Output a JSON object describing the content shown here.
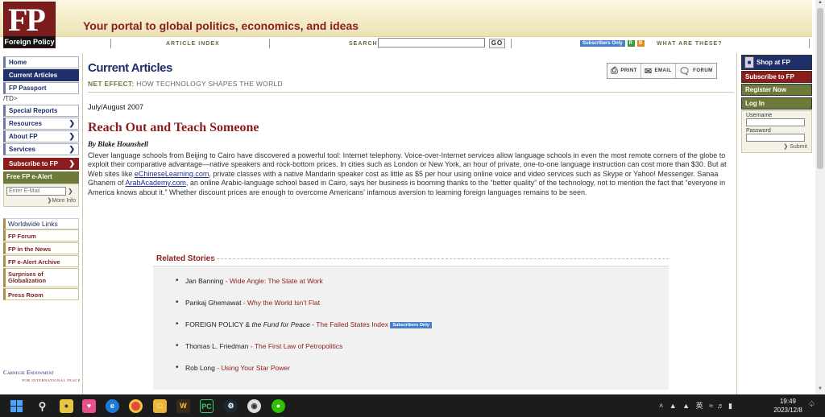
{
  "header": {
    "logo_initials": "FP",
    "logo_name": "Foreign Policy",
    "tagline": "Your portal to global politics, economics, and ideas"
  },
  "navbar": {
    "article_index": "ARTICLE INDEX",
    "search_label": "SEARCH",
    "search_value": "",
    "go_label": "GO",
    "subscribers_only": "Subscribers Only",
    "badge_r": "R",
    "badge_b": "B",
    "what_are_these": "WHAT ARE THESE?"
  },
  "left_nav": {
    "items": [
      {
        "label": "Home"
      },
      {
        "label": "Current Articles"
      },
      {
        "label": "FP Passport"
      }
    ],
    "stray_text": "/TD>",
    "items2": [
      {
        "label": "Special Reports"
      },
      {
        "label": "Resources"
      },
      {
        "label": "About FP"
      },
      {
        "label": "Services"
      }
    ],
    "subscribe": "Subscribe to FP",
    "ealert_title": "Free FP e-Alert",
    "email_placeholder": "Enter E-Mail",
    "more_info": "More Info",
    "worldwide_links": "Worldwide Links",
    "links": [
      {
        "label": "FP Forum"
      },
      {
        "label": "FP in the News"
      },
      {
        "label": "FP e-Alert Archive"
      },
      {
        "label": "Surprises of Globalization"
      },
      {
        "label": "Press Room"
      }
    ],
    "carnegie": "Carnegie Endowment",
    "carnegie_sub": "FOR INTERNATIONAL PEACE"
  },
  "main": {
    "section_title": "Current Articles",
    "tools": {
      "print": "PRINT",
      "email": "EMAIL",
      "forum": "FORUM"
    },
    "section_label": "NET EFFECT:",
    "section_desc": "HOW TECHNOLOGY SHAPES THE WORLD",
    "issue_date": "July/August 2007",
    "headline": "Reach Out and Teach Someone",
    "byline": "By Blake Hounshell",
    "body": {
      "p1": "Clever language schools from Beijing to Cairo have discovered a powerful tool: Internet telephony. Voice-over-Internet services allow language schools in even the most remote corners of the globe to exploit their comparative advantage—native speakers and rock-bottom prices. In cities such as London or New York, an hour of private, one-to-one language instruction can cost more than $30. But at Web sites like ",
      "link1": "eChineseLearning.com",
      "p2": ", private classes with a native Mandarin speaker cost as little as $5 per hour using online voice and video services such as Skype or Yahoo! Messenger. Sanaa Ghanem of ",
      "link2": "ArabAcademy.com",
      "p3": ", an online Arabic-language school based in Cairo, says her business is booming thanks to the “better quality” of the technology, not to mention the fact that “everyone in America knows about it.” Whether discount prices are enough to overcome Americans’ infamous aversion to learning foreign languages remains to be seen."
    }
  },
  "related": {
    "title": "Related Stories",
    "items": [
      {
        "author": "Jan Banning",
        "sep": " - ",
        "title": "Wide Angle: The State at Work"
      },
      {
        "author": "Pankaj Ghemawat",
        "sep": " - ",
        "title": "Why the World Isn’t Flat"
      },
      {
        "author_pre": "FOREIGN POLICY & ",
        "author_em": "the Fund for Peace",
        "sep": " - ",
        "title": "The Failed States Index",
        "badge": "Subscribers Only"
      },
      {
        "author": "Thomas L. Friedman",
        "sep": " - ",
        "title": "The First Law of Petropolitics"
      },
      {
        "author": "Rob Long",
        "sep": " - ",
        "title": "Using Your Star Power"
      }
    ]
  },
  "right_nav": {
    "shop": "Shop at FP",
    "subscribe": "Subscribe to FP",
    "register": "Register Now",
    "login_title": "Log In",
    "username_label": "Username",
    "password_label": "Password",
    "submit": "Submit"
  },
  "taskbar": {
    "tray_text": "英",
    "time": "19:49",
    "date": "2023/12/8"
  }
}
